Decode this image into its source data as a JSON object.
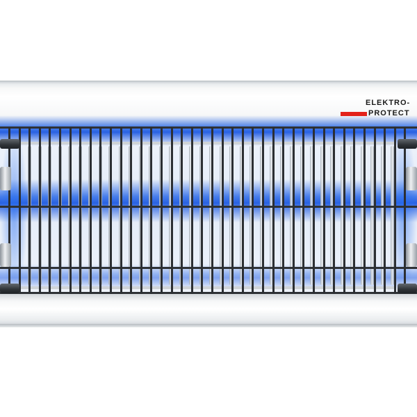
{
  "product": {
    "type": "insect-killer-lamp",
    "logo": {
      "line1": "ELEKTRO-",
      "line2": "PROTECT",
      "accent_color": "#e32119"
    },
    "colors": {
      "uv_glow": "#2b6ae8",
      "housing": "#f4f5f6",
      "grid_wire": "#2f3236",
      "electrode": "#c7ccd1"
    }
  }
}
